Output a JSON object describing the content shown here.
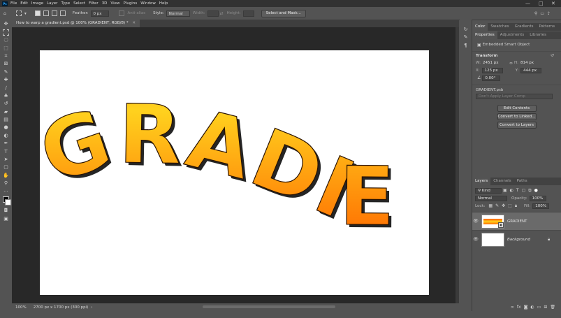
{
  "menu": {
    "app_icon_text": "Ps",
    "items": [
      "File",
      "Edit",
      "Image",
      "Layer",
      "Type",
      "Select",
      "Filter",
      "3D",
      "View",
      "Plugins",
      "Window",
      "Help"
    ],
    "window_controls": [
      "—",
      "□",
      "✕"
    ]
  },
  "options": {
    "feather_label": "Feather:",
    "feather_value": "0 px",
    "antialias_label": "Anti-alias",
    "style_label": "Style:",
    "style_value": "Normal",
    "width_label": "Width:",
    "height_label": "Height:",
    "select_mask_label": "Select and Mask..."
  },
  "document": {
    "tab_title": "How to warp a gradient.psd @ 100% (GRADIENT, RGB/8) *",
    "canvas_text": "GRADIENT",
    "zoom": "100%",
    "doc_info": "2700 px x 1700 px (300 ppi)"
  },
  "colors": {
    "gradient_top": "#ff5a00",
    "gradient_mid": "#ffd21e",
    "gradient_bottom": "#ff6a00",
    "accent_blue": "#31a8ff"
  },
  "top_panel": {
    "tabs": [
      "Color",
      "Swatches",
      "Gradients",
      "Patterns"
    ]
  },
  "properties": {
    "tabs": [
      "Properties",
      "Adjustments",
      "Libraries"
    ],
    "object_type": "Embedded Smart Object",
    "transform_title": "Transform",
    "w_label": "W:",
    "w_value": "2451 px",
    "h_label": "H:",
    "h_value": "814 px",
    "x_label": "X:",
    "x_value": "125 px",
    "y_label": "Y:",
    "y_value": "444 px",
    "angle_value": "0.00°",
    "file_name": "GRADIENT.psb",
    "layer_comp_placeholder": "Don't Apply Layer Comp",
    "buttons": [
      "Edit Contents",
      "Convert to Linked...",
      "Convert to Layers"
    ]
  },
  "layers": {
    "tabs": [
      "Layers",
      "Channels",
      "Paths"
    ],
    "kind_label": "Kind",
    "blend_mode": "Normal",
    "opacity_label": "Opacity:",
    "opacity_value": "100%",
    "lock_label": "Lock:",
    "fill_label": "Fill:",
    "fill_value": "100%",
    "items": [
      {
        "name": "GRADIENT"
      },
      {
        "name": "Background"
      }
    ]
  }
}
